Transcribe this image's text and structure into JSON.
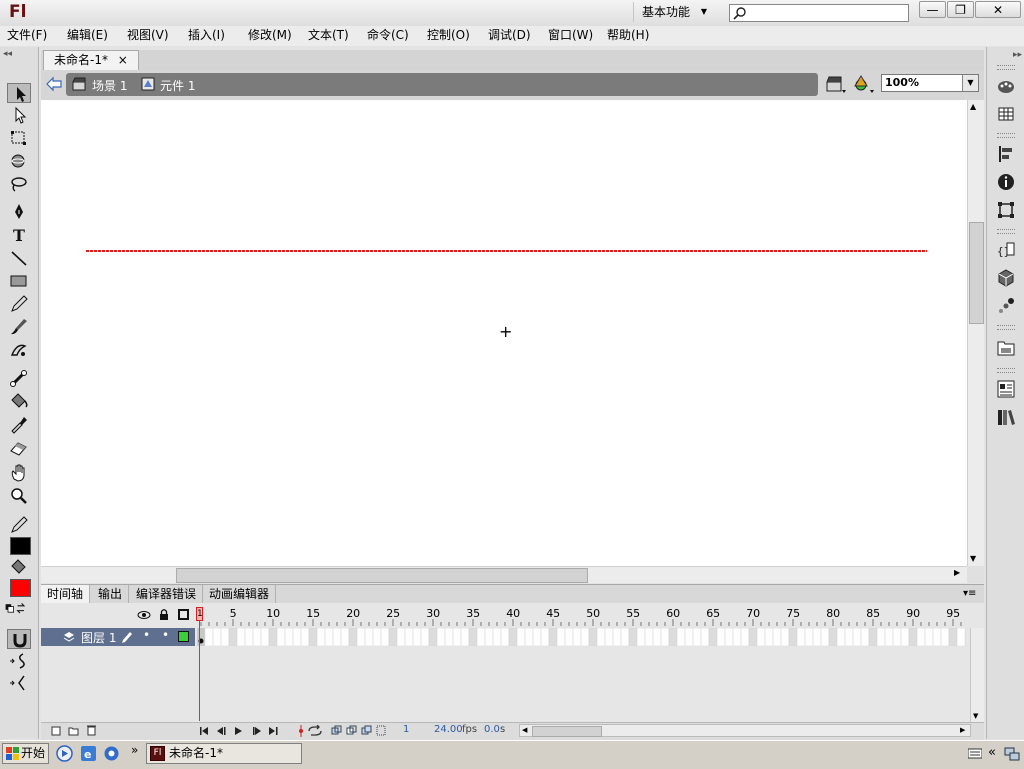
{
  "app": {
    "logo_text": "Fl",
    "workspace_label": "基本功能",
    "search_placeholder": "",
    "window_buttons": [
      "—",
      "❐",
      "✕"
    ]
  },
  "menu": [
    "文件(F)",
    "编辑(E)",
    "视图(V)",
    "插入(I)",
    "修改(M)",
    "文本(T)",
    "命令(C)",
    "控制(O)",
    "调试(D)",
    "窗口(W)",
    "帮助(H)"
  ],
  "document": {
    "tab_label": "未命名-1*",
    "close_glyph": "×",
    "breadcrumb": [
      "场景 1",
      "元件 1"
    ],
    "zoom_value": "100%"
  },
  "stage": {
    "stroke_color": "#e21b1b",
    "crosshair": "+"
  },
  "timeline": {
    "tabs": [
      "时间轴",
      "输出",
      "编译器错误",
      "动画编辑器"
    ],
    "frame_numbers": [
      "1",
      "5",
      "10",
      "15",
      "20",
      "25",
      "30",
      "35",
      "40",
      "45",
      "50",
      "55",
      "60",
      "65",
      "70",
      "75",
      "80",
      "85",
      "90",
      "95"
    ],
    "layer_name": "图层 1",
    "layer_color": "#3ccd3c",
    "current_frame": "1",
    "fps_value": "24.00",
    "fps_unit": "fps",
    "elapsed_value": "0.0",
    "elapsed_unit": "s"
  },
  "tools": {
    "stroke_color": "#000000",
    "fill_color": "#ff0000"
  },
  "taskbar": {
    "start_label": "开始",
    "task_label": "未命名-1*",
    "overflow": "»"
  },
  "right_dock": {
    "collapse": "»"
  }
}
